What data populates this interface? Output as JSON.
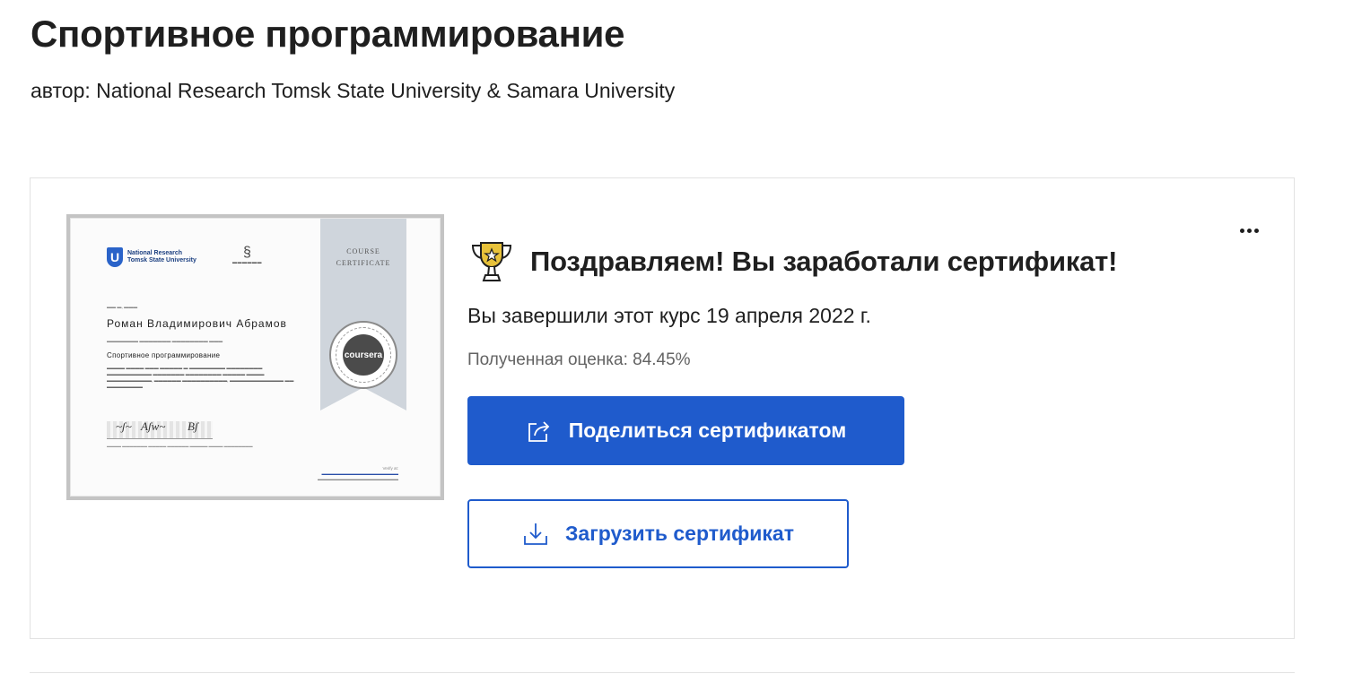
{
  "header": {
    "title": "Спортивное программирование",
    "author_label": "автор:",
    "author_name": "National Research Tomsk State University & Samara University"
  },
  "certificate": {
    "ribbon_text": "COURSE\nCERTIFICATE",
    "logo1_text": "National Research\nTomsk State University",
    "logo1_letter": "U",
    "seal_text": "coursera",
    "recipient_name": "Роман Владимирович Абрамов",
    "course_name": "Спортивное программирование",
    "verify_label": "Verify at:"
  },
  "summary": {
    "congrats": "Поздравляем! Вы заработали сертификат!",
    "completed": "Вы завершили этот курс 19 апреля 2022 г.",
    "grade": "Полученная оценка: 84.45%"
  },
  "actions": {
    "share_label": "Поделиться сертификатом",
    "download_label": "Загрузить сертификат",
    "more_icon": "more-horizontal-icon"
  },
  "colors": {
    "primary": "#1f5bcc",
    "trophy": "#e8c23a",
    "muted_text": "#636363"
  }
}
